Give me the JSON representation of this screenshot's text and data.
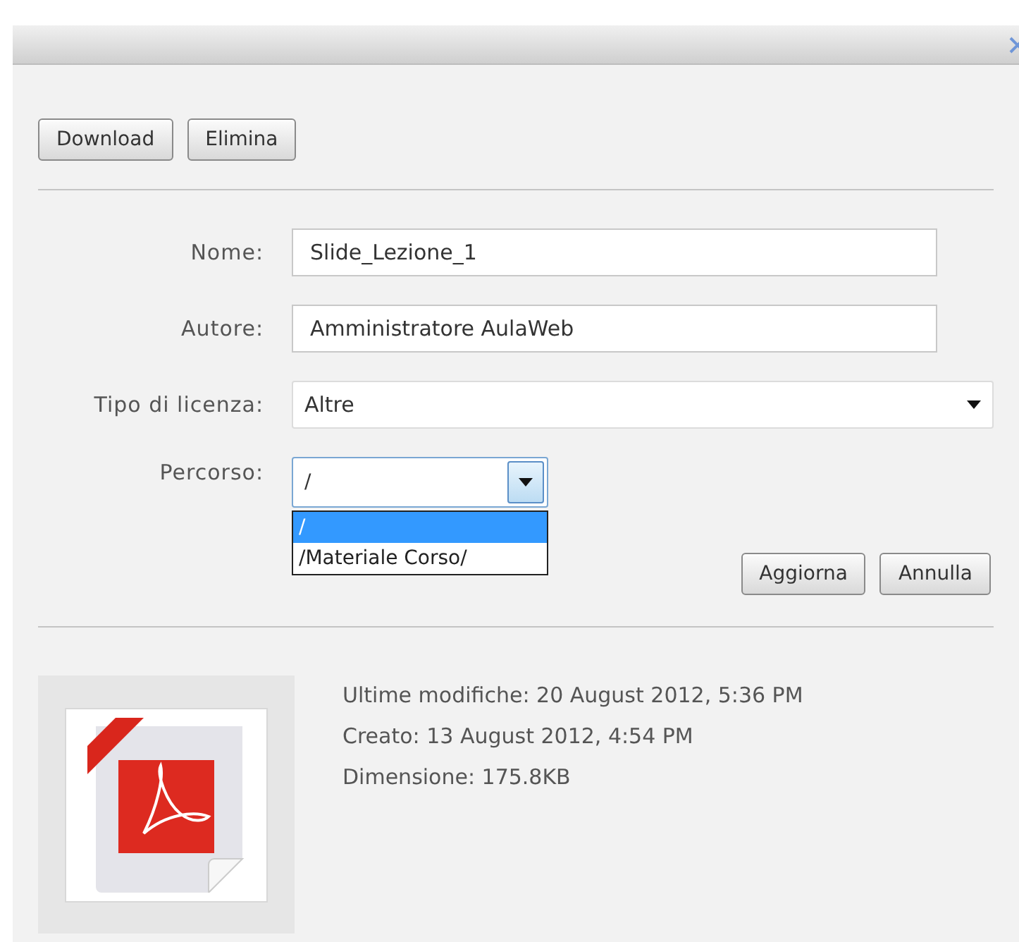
{
  "actions": [
    "Download",
    "Elimina"
  ],
  "fields": [
    {
      "kind": "text",
      "label": "Nome:",
      "value": "Slide_Lezione_1"
    },
    {
      "kind": "text",
      "label": "Autore:",
      "value": "Amministratore AulaWeb"
    },
    {
      "kind": "select",
      "label": "Tipo di licenza:",
      "value": "Altre"
    },
    {
      "kind": "combo",
      "label": "Percorso:",
      "value": "/",
      "options": [
        {
          "label": "/",
          "selected": true
        },
        {
          "label": "/Materiale Corso/",
          "selected": false
        }
      ]
    }
  ],
  "form_buttons": [
    "Aggiorna",
    "Annulla"
  ],
  "details": [
    "Ultime modifiche: 20 August 2012, 5:36 PM",
    "Creato: 13 August 2012, 4:54 PM",
    "Dimensione: 175.8KB"
  ]
}
